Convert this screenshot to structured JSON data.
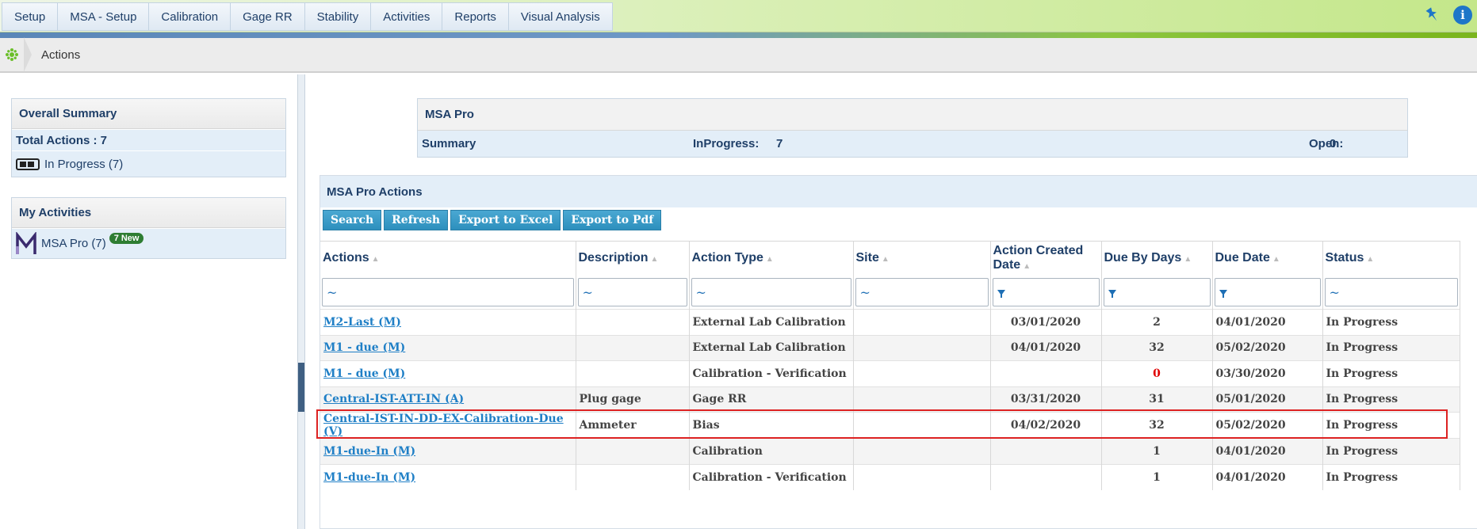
{
  "nav": {
    "tabs": [
      "Setup",
      "MSA - Setup",
      "Calibration",
      "Gage RR",
      "Stability",
      "Activities",
      "Reports",
      "Visual Analysis"
    ],
    "icons": [
      "pin-icon",
      "info-icon"
    ],
    "info_glyph": "i"
  },
  "breadcrumb": {
    "current": "Actions"
  },
  "overall_summary": {
    "title": "Overall Summary",
    "total_actions": "Total Actions : 7",
    "in_progress": "In Progress (7)"
  },
  "my_activities": {
    "title": "My Activities",
    "item_label": "MSA Pro (7)",
    "new_badge": "7 New"
  },
  "summary": {
    "title": "MSA Pro",
    "label": "Summary",
    "inprogress_label": "InProgress:",
    "inprogress_value": "7",
    "open_label": "Open:",
    "open_value": "0"
  },
  "actions": {
    "title": "MSA Pro Actions",
    "buttons": [
      "Search",
      "Refresh",
      "Export to Excel",
      "Export to Pdf"
    ],
    "columns": [
      "Actions",
      "Description",
      "Action Type",
      "Site",
      "Action Created Date",
      "Due By Days",
      "Due Date",
      "Status"
    ],
    "filter_glyph": "~",
    "rows": [
      [
        "M2-Last (M)",
        "",
        "External Lab Calibration",
        "",
        "03/01/2020",
        "2",
        "04/01/2020",
        "In Progress"
      ],
      [
        "M1 - due (M)",
        "",
        "External Lab Calibration",
        "",
        "04/01/2020",
        "32",
        "05/02/2020",
        "In Progress"
      ],
      [
        "M1 - due (M)",
        "",
        "Calibration - Verification",
        "",
        "",
        "0",
        "03/30/2020",
        "In Progress"
      ],
      [
        "Central-IST-ATT-IN (A)",
        "Plug gage",
        "Gage RR",
        "",
        "03/31/2020",
        "31",
        "05/01/2020",
        "In Progress"
      ],
      [
        "Central-IST-IN-DD-EX-Calibration-Due (V)",
        "Ammeter",
        "Bias",
        "",
        "04/02/2020",
        "32",
        "05/02/2020",
        "In Progress"
      ],
      [
        "M1-due-In (M)",
        "",
        "Calibration",
        "",
        "",
        "1",
        "04/01/2020",
        "In Progress"
      ],
      [
        "M1-due-In (M)",
        "",
        "Calibration - Verification",
        "",
        "",
        "1",
        "04/01/2020",
        "In Progress"
      ]
    ]
  },
  "colors": {
    "accent": "#1f3f68",
    "link": "#1f7fc6",
    "button": "#2d8fbd",
    "overdue": "#e00000",
    "highlight": "#dd2222"
  }
}
